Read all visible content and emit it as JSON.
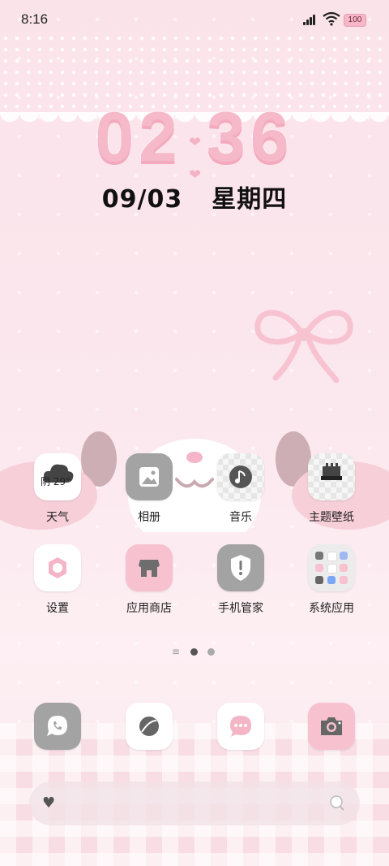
{
  "status_bar": {
    "time": "8:16",
    "battery": "100"
  },
  "lock_clock": {
    "hour": "02",
    "minute": "36"
  },
  "date": {
    "day": "09/03",
    "weekday": "星期四"
  },
  "apps": [
    {
      "label": "天气",
      "icon": "weather-cloud-icon",
      "widget_text": "阴 29°"
    },
    {
      "label": "相册",
      "icon": "gallery-icon"
    },
    {
      "label": "音乐",
      "icon": "music-icon"
    },
    {
      "label": "主题壁纸",
      "icon": "theme-brush-icon"
    },
    {
      "label": "设置",
      "icon": "settings-gear-icon"
    },
    {
      "label": "应用商店",
      "icon": "app-store-icon"
    },
    {
      "label": "手机管家",
      "icon": "phone-manager-shield-icon"
    },
    {
      "label": "系统应用",
      "icon": "folder-icon"
    }
  ],
  "pager": {
    "pages": 2,
    "current": 1
  },
  "dock": [
    {
      "icon": "phone-icon"
    },
    {
      "icon": "browser-icon"
    },
    {
      "icon": "messages-icon"
    },
    {
      "icon": "camera-icon"
    }
  ],
  "search_bar": {
    "left_icon": "heart-icon",
    "right_icon": "search-icon"
  },
  "colors": {
    "accent_pink": "#f7c1d0",
    "clock_pink": "#f5b9c9",
    "icon_gray": "#a3a3a3"
  }
}
